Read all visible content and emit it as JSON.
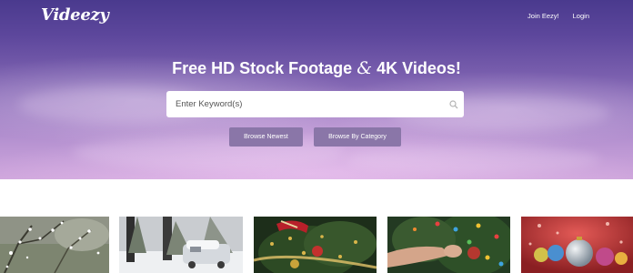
{
  "header": {
    "logo": "Videezy",
    "nav": {
      "join": "Join Eezy!",
      "login": "Login"
    }
  },
  "hero": {
    "title_part1": "Free HD Stock Footage",
    "title_amp": "&",
    "title_part2": "4K Videos!"
  },
  "search": {
    "placeholder": "Enter Keyword(s)",
    "value": "",
    "icon": "search-icon"
  },
  "buttons": {
    "browse_newest": "Browse Newest",
    "browse_category": "Browse By Category"
  },
  "thumbnails": [
    {
      "subject": "snowy-branches"
    },
    {
      "subject": "snowy-street-car"
    },
    {
      "subject": "christmas-tree-ribbon"
    },
    {
      "subject": "hand-decorating-tree"
    },
    {
      "subject": "christmas-ornaments"
    }
  ],
  "colors": {
    "button": "#8a76a8",
    "hero_top": "#4a3a8e",
    "hero_bottom": "#cfa6dc"
  }
}
